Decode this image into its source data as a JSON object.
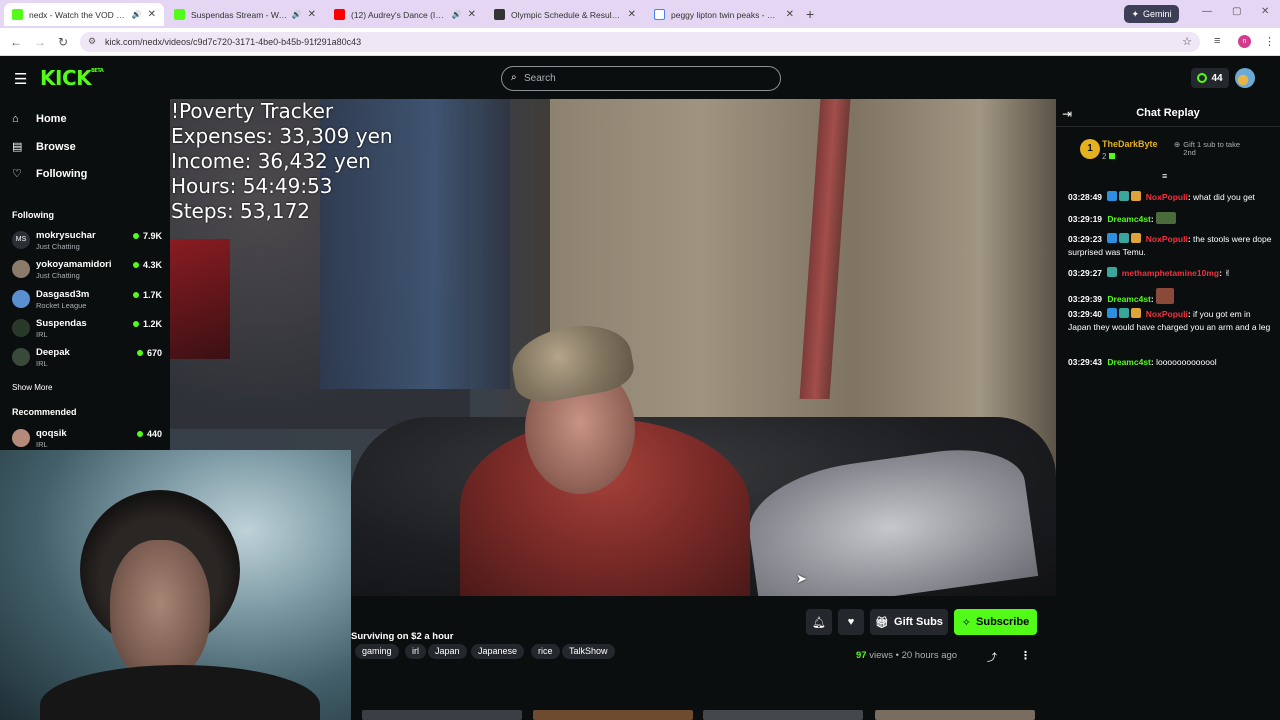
{
  "browser": {
    "tabs": [
      {
        "title": "nedx - Watch the VOD on K",
        "active": true,
        "audio": true
      },
      {
        "title": "Suspendas Stream - Watch Live",
        "active": false,
        "audio": true
      },
      {
        "title": "(12) Audrey's Dance (Instru",
        "active": false,
        "audio": true
      },
      {
        "title": "Olympic Schedule & Results | N",
        "active": false,
        "audio": false
      },
      {
        "title": "peggy lipton twin peaks - Goog",
        "active": false,
        "audio": false
      }
    ],
    "gemini_label": "Gemini",
    "url": "kick.com/nedx/videos/c9d7c720-3171-4be0-b45b-91f291a80c43",
    "profile_initial": "n"
  },
  "header": {
    "logo": "KICK",
    "logo_beta": "BETA",
    "search_placeholder": "Search",
    "points": "44"
  },
  "sidebar": {
    "nav": [
      {
        "label": "Home",
        "icon": "home-icon"
      },
      {
        "label": "Browse",
        "icon": "browse-icon"
      },
      {
        "label": "Following",
        "icon": "heart-icon"
      }
    ],
    "following_heading": "Following",
    "following": [
      {
        "name": "mokrysuchar",
        "category": "Just Chatting",
        "viewers": "7.9K"
      },
      {
        "name": "yokoyamamidori",
        "category": "Just Chatting",
        "viewers": "4.3K"
      },
      {
        "name": "Dasgasd3m",
        "category": "Rocket League",
        "viewers": "1.7K"
      },
      {
        "name": "Suspendas",
        "category": "IRL",
        "viewers": "1.2K"
      },
      {
        "name": "Deepak",
        "category": "IRL",
        "viewers": "670"
      }
    ],
    "show_more": "Show More",
    "recommended_heading": "Recommended",
    "recommended": [
      {
        "name": "qoqsik",
        "category": "IRL",
        "viewers": "440"
      }
    ]
  },
  "video": {
    "overlay_lines": [
      "!Poverty Tracker",
      "Expenses: 33,309 yen",
      "Income: 36,432 yen",
      "Hours: 54:49:53",
      "Steps: 53,172"
    ]
  },
  "below_player": {
    "title": "Surviving on $2 a hour",
    "tags": [
      "gaming",
      "irl",
      "Japan",
      "Japanese",
      "rice",
      "TalkShow"
    ],
    "gift_subs_label": "Gift Subs",
    "subscribe_label": "Subscribe",
    "views_count": "97",
    "views_label": "views",
    "age": "20 hours ago"
  },
  "chat": {
    "title": "Chat Replay",
    "top_gifter": {
      "rank": "1",
      "name": "TheDarkByte",
      "count": "2"
    },
    "gift_cta": "Gift 1 sub to take 2nd",
    "messages": [
      {
        "time": "03:28:49",
        "user": "NoxPopuli",
        "user_color": "#f2313e",
        "text": "what did you get",
        "badges": 3
      },
      {
        "time": "03:29:19",
        "user": "Dreamc4st",
        "user_color": "#53fc18",
        "text": "",
        "badges": 0,
        "emote": true
      },
      {
        "time": "03:29:23",
        "user": "NoxPopuli",
        "user_color": "#f2313e",
        "text": "the stools were dope surprised was Temu.",
        "badges": 3
      },
      {
        "time": "03:29:27",
        "user": "methamphetamine10mg",
        "user_color": "#f2313e",
        "text": "",
        "badges": 1,
        "emote": true
      },
      {
        "time": "03:29:39",
        "user": "Dreamc4st",
        "user_color": "#53fc18",
        "text": "",
        "badges": 0,
        "emote": true
      },
      {
        "time": "03:29:40",
        "user": "NoxPopuli",
        "user_color": "#f2313e",
        "text": "if you got em in Japan they would have charged you an arm and a leg",
        "badges": 3
      },
      {
        "time": "03:29:43",
        "user": "Dreamc4st",
        "user_color": "#53fc18",
        "text": "looooooooooool",
        "badges": 0
      }
    ]
  },
  "colors": {
    "accent": "#53fc18",
    "background": "#0b0e0f",
    "surface": "#24272c",
    "gold": "#e5b11e"
  }
}
